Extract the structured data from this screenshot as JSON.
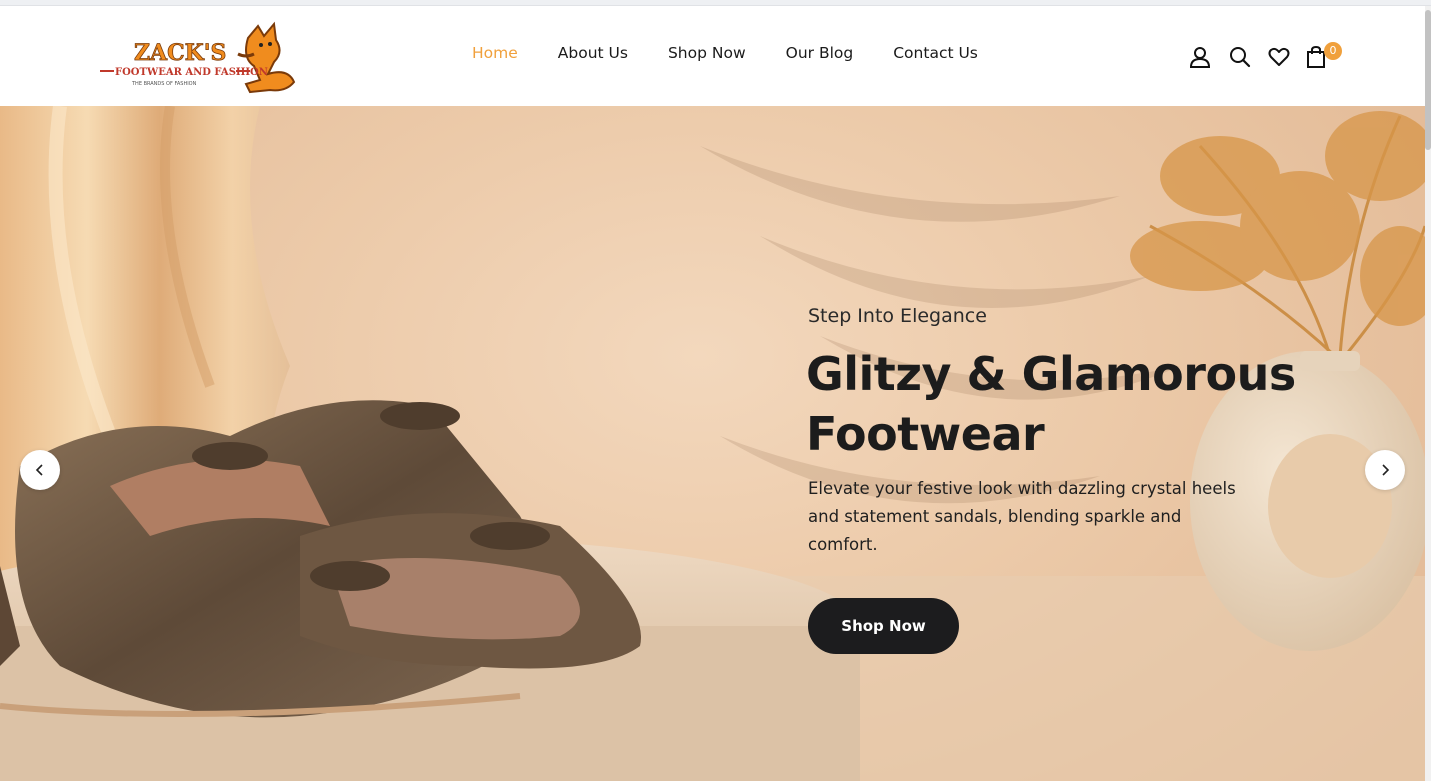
{
  "brand": {
    "logo_text_main": "ZACK'S",
    "logo_text_sub": "FOOTWEAR AND FASHION",
    "logo_tagline": "THE BRANDS OF FASHION",
    "accent_color": "#f0a03c",
    "logo_red": "#c0392b"
  },
  "nav": {
    "items": [
      {
        "label": "Home",
        "active": true
      },
      {
        "label": "About Us",
        "active": false
      },
      {
        "label": "Shop Now",
        "active": false
      },
      {
        "label": "Our Blog",
        "active": false
      },
      {
        "label": "Contact Us",
        "active": false
      }
    ]
  },
  "header_icons": {
    "account": "user-icon",
    "search": "search-icon",
    "wishlist": "heart-icon",
    "cart": "shopping-bag-icon",
    "cart_count": "0"
  },
  "hero": {
    "subtitle": "Step Into Elegance",
    "title": "Glitzy & Glamorous Footwear",
    "description": "Elevate your festive look with dazzling crystal heels and statement sandals, blending sparkle and comfort.",
    "cta_label": "Shop Now",
    "prev_icon": "chevron-left-icon",
    "next_icon": "chevron-right-icon"
  }
}
